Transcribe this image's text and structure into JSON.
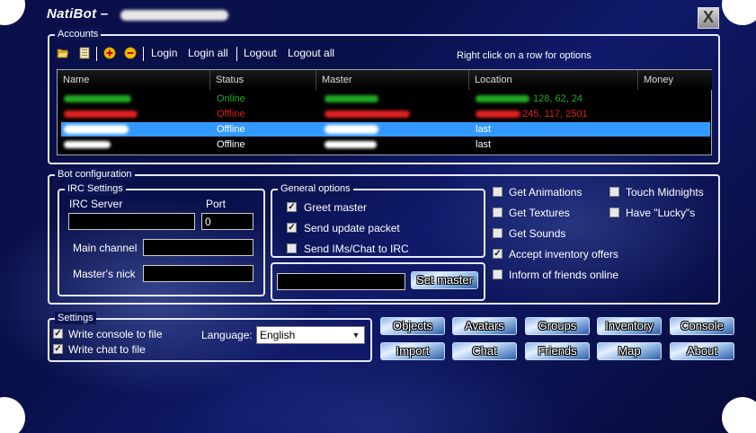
{
  "window": {
    "title": "NatiBot –",
    "close_label": "X"
  },
  "accounts": {
    "legend": "Accounts",
    "toolbar": {
      "login": "Login",
      "login_all": "Login all",
      "logout": "Logout",
      "logout_all": "Logout all",
      "hint": "Right click on a row for options"
    },
    "columns": [
      "Name",
      "Status",
      "Master",
      "Location",
      "Money"
    ],
    "rows": [
      {
        "status": "Online",
        "location": "128, 62, 24",
        "color": "#22aa22"
      },
      {
        "status": "Offline",
        "location": "245, 117, 2501",
        "color": "#e02020"
      },
      {
        "status": "Offline",
        "location": "last",
        "color": "#ffffff"
      },
      {
        "status": "Offline",
        "location": "last",
        "color": "#ffffff"
      }
    ]
  },
  "bot_config": {
    "legend": "Bot configuration",
    "irc": {
      "legend": "IRC Settings",
      "server_label": "IRC Server",
      "port_label": "Port",
      "port_value": "0",
      "channel_label": "Main channel",
      "nick_label": "Master's nick"
    },
    "general": {
      "legend": "General options",
      "options": [
        {
          "label": "Greet master",
          "checked": true
        },
        {
          "label": "Send update packet",
          "checked": true
        },
        {
          "label": "Send IMs/Chat to IRC",
          "checked": false
        }
      ]
    },
    "set_master_label": "Set master",
    "checks_left": [
      {
        "label": "Get Animations",
        "checked": false
      },
      {
        "label": "Get Textures",
        "checked": false
      },
      {
        "label": "Get Sounds",
        "checked": false
      },
      {
        "label": "Accept inventory offers",
        "checked": true
      },
      {
        "label": "Inform of friends online",
        "checked": false
      }
    ],
    "checks_right": [
      {
        "label": "Touch Midnights",
        "checked": false
      },
      {
        "label": "Have \"Lucky\"s",
        "checked": false
      }
    ]
  },
  "settings": {
    "legend": "Settings",
    "write_console": "Write console to file",
    "write_chat": "Write chat to file",
    "language_label": "Language:",
    "language_value": "English"
  },
  "buttons": {
    "objects": "Objects",
    "avatars": "Avatars",
    "groups": "Groups",
    "inventory": "Inventory",
    "console": "Console",
    "import": "Import",
    "chat": "Chat",
    "friends": "Friends",
    "map": "Map",
    "about": "About"
  },
  "colors": {
    "selection": "#3399ff",
    "online": "#22aa22",
    "offline_error": "#e02020"
  }
}
